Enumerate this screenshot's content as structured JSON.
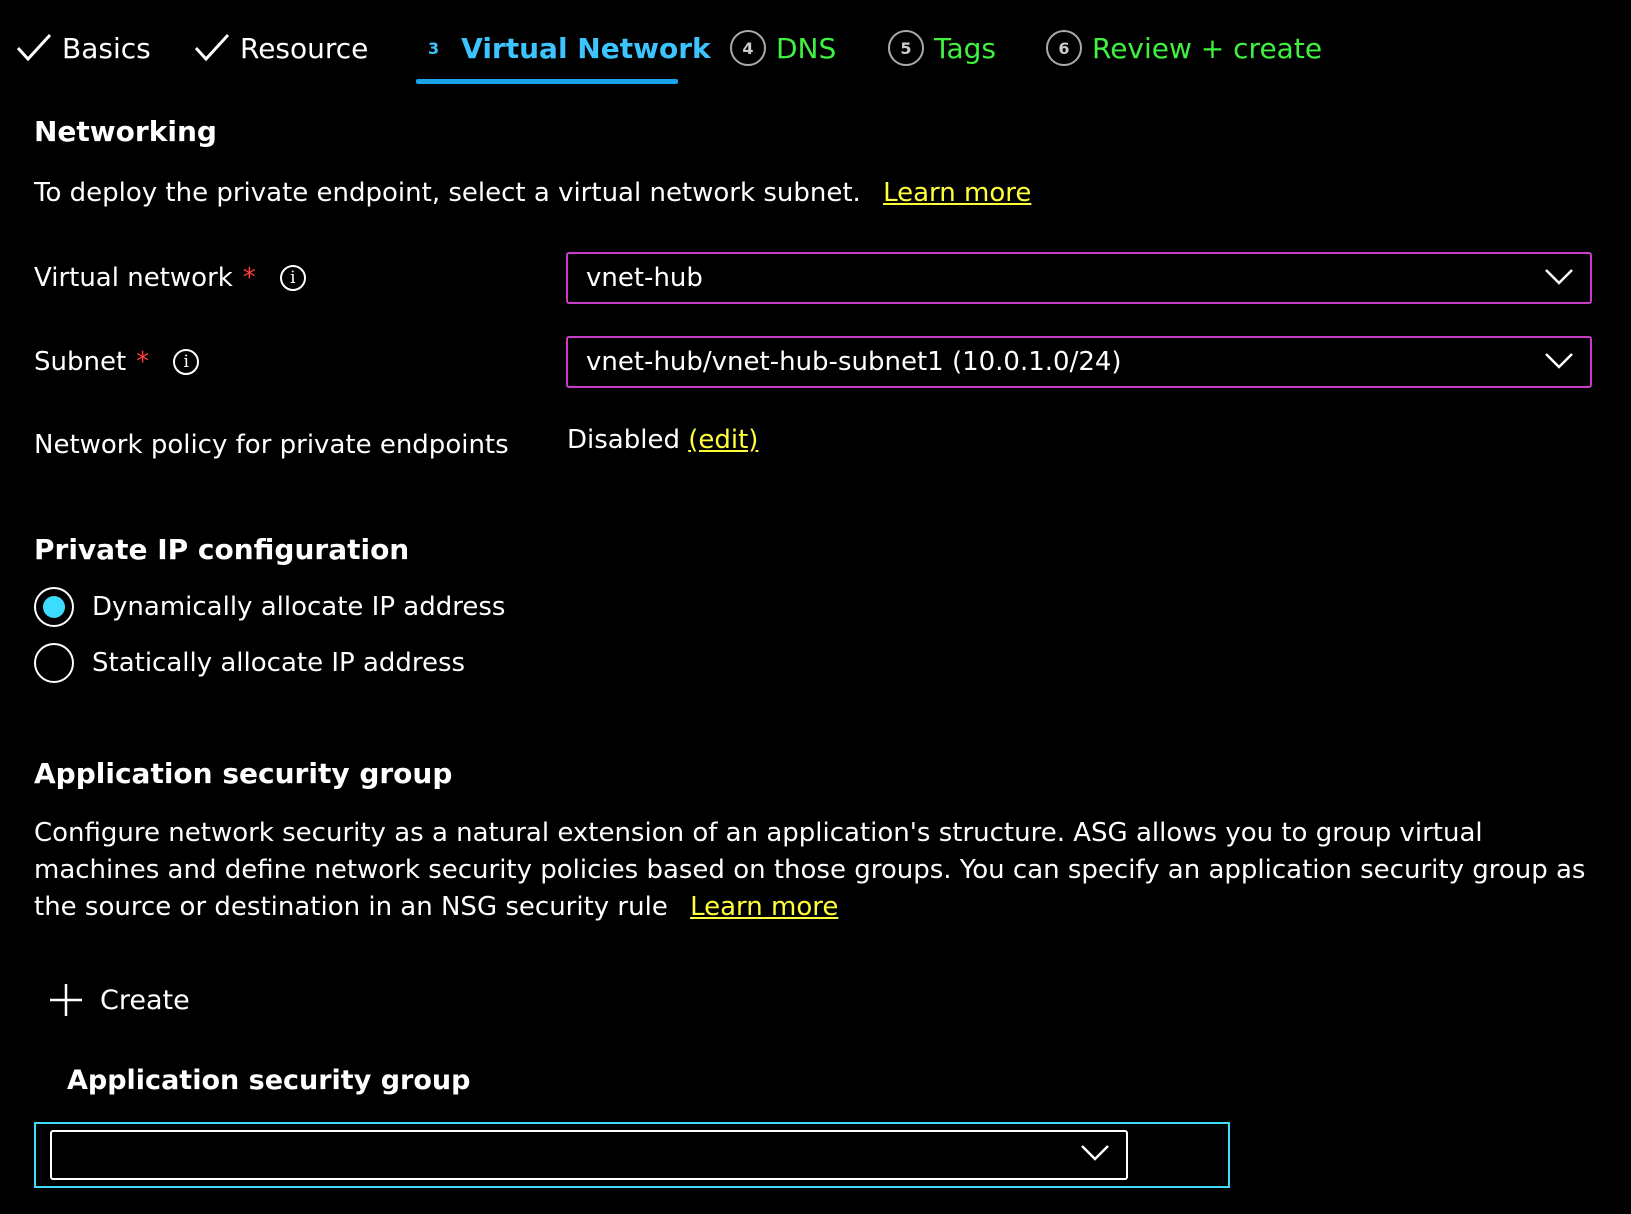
{
  "tabs": [
    {
      "label": "Basics",
      "state": "done",
      "icon": "checkmark-icon"
    },
    {
      "label": "Resource",
      "state": "done",
      "icon": "checkmark-icon"
    },
    {
      "number": "3",
      "label": "Virtual Network",
      "state": "current"
    },
    {
      "number": "4",
      "label": "DNS",
      "state": "future"
    },
    {
      "number": "5",
      "label": "Tags",
      "state": "future"
    },
    {
      "number": "6",
      "label": "Review + create",
      "state": "future"
    }
  ],
  "networking": {
    "title": "Networking",
    "description": "To deploy the private endpoint, select a virtual network subnet.",
    "learn_more": "Learn more",
    "virtual_network": {
      "label": "Virtual network",
      "required": "*",
      "value": "vnet-hub"
    },
    "subnet": {
      "label": "Subnet",
      "required": "*",
      "value": "vnet-hub/vnet-hub-subnet1 (10.0.1.0/24)"
    },
    "network_policy": {
      "label": "Network policy for private endpoints",
      "value": "Disabled",
      "edit_link": "(edit)"
    }
  },
  "private_ip": {
    "title": "Private IP configuration",
    "options": [
      {
        "label": "Dynamically allocate IP address",
        "selected": true
      },
      {
        "label": "Statically allocate IP address",
        "selected": false
      }
    ]
  },
  "asg": {
    "title": "Application security group",
    "description": "Configure network security as a natural extension of an application's structure. ASG allows you to group virtual machines and define network security policies based on those groups. You can specify an application security group as the source or destination in an NSG security rule",
    "learn_more": "Learn more",
    "create_label": "Create",
    "column_header": "Application security group",
    "dropdown_value": ""
  },
  "colors": {
    "current_tab": "#3cc4ff",
    "future_tab": "#3ff23f",
    "link": "#ffff3c",
    "required": "#ff3c3c",
    "dropdown_border": "#c83cc8",
    "focus_border": "#3cdcff"
  }
}
